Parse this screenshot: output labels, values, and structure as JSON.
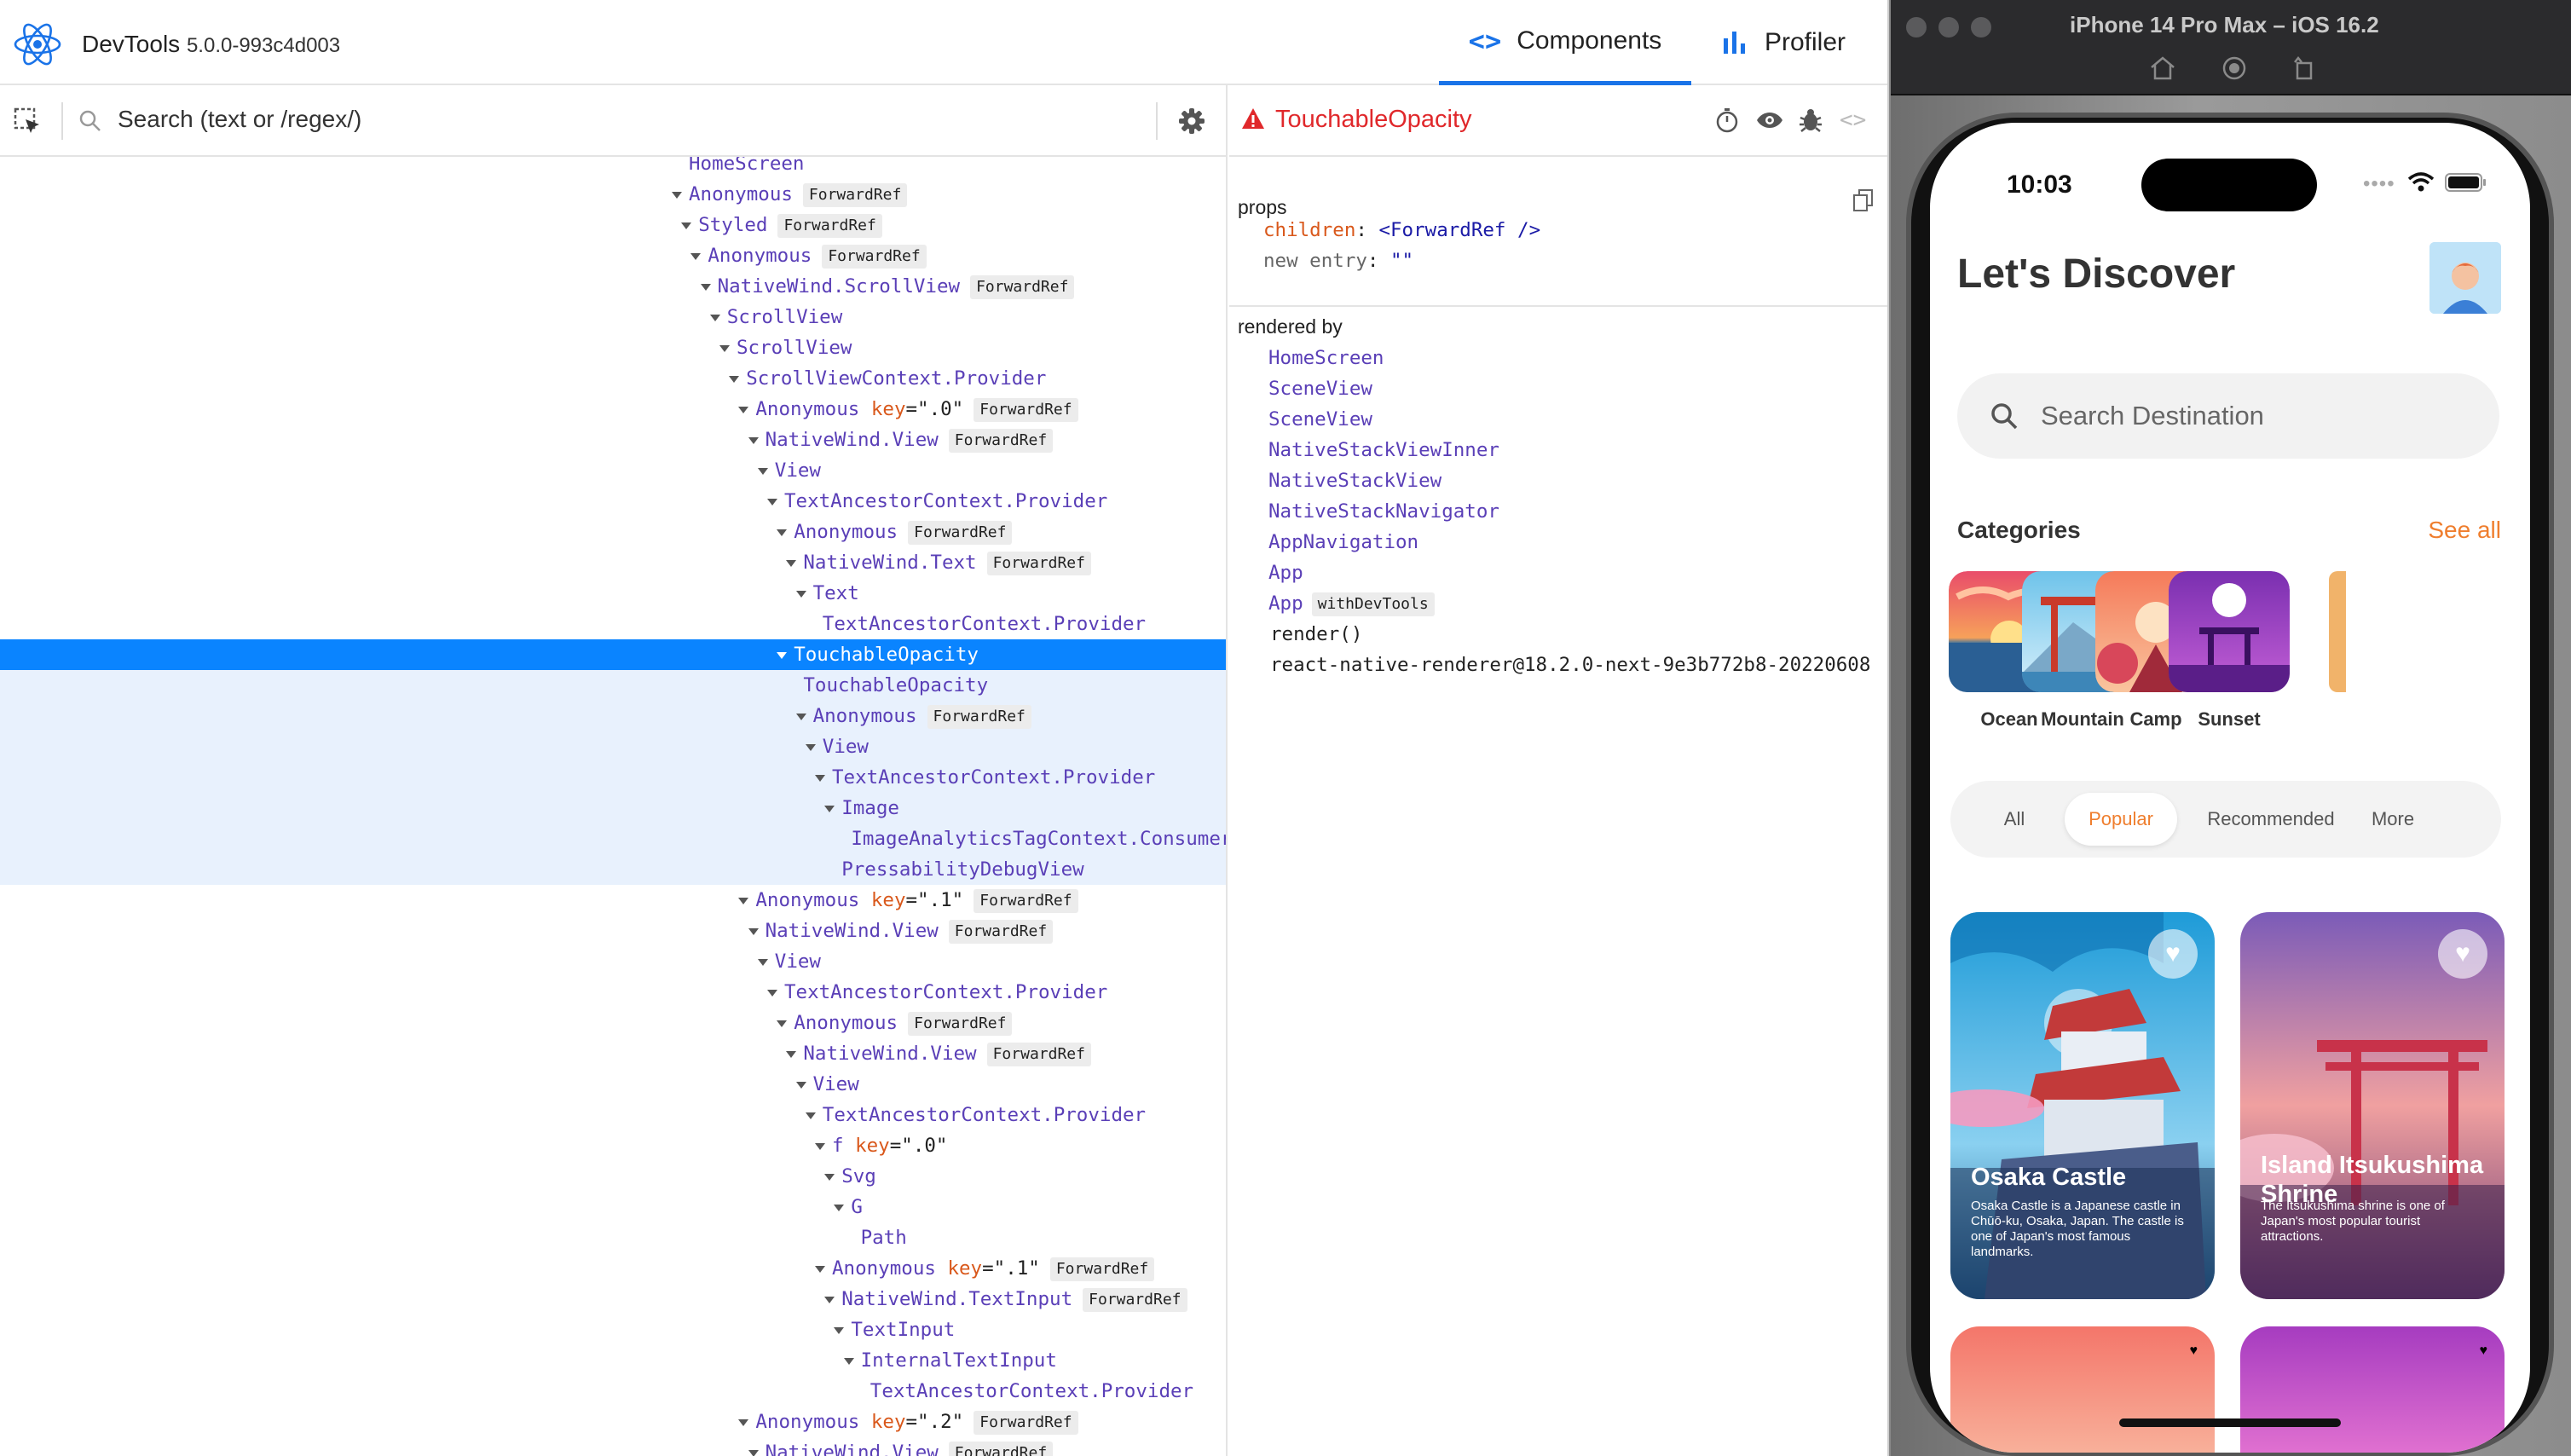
{
  "devtools": {
    "app_name": "DevTools",
    "version": "5.0.0-993c4d003",
    "tabs": [
      {
        "label": "Components",
        "active": true
      },
      {
        "label": "Profiler",
        "active": false
      }
    ],
    "search_placeholder": "Search (text or /regex/)",
    "tree": [
      {
        "indent": 0,
        "name": "HomeScreen",
        "partial": true
      },
      {
        "indent": 0,
        "name": "Anonymous",
        "badge": "ForwardRef",
        "caret": true
      },
      {
        "indent": 1,
        "name": "Styled",
        "badge": "ForwardRef",
        "caret": true
      },
      {
        "indent": 2,
        "name": "Anonymous",
        "badge": "ForwardRef",
        "caret": true
      },
      {
        "indent": 3,
        "name": "NativeWind.ScrollView",
        "badge": "ForwardRef",
        "caret": true
      },
      {
        "indent": 4,
        "name": "ScrollView",
        "caret": true
      },
      {
        "indent": 5,
        "name": "ScrollView",
        "caret": true
      },
      {
        "indent": 6,
        "name": "ScrollViewContext.Provider",
        "caret": true
      },
      {
        "indent": 7,
        "name": "Anonymous",
        "key": "\".0\"",
        "badge": "ForwardRef",
        "caret": true
      },
      {
        "indent": 8,
        "name": "NativeWind.View",
        "badge": "ForwardRef",
        "caret": true
      },
      {
        "indent": 9,
        "name": "View",
        "caret": true
      },
      {
        "indent": 10,
        "name": "TextAncestorContext.Provider",
        "caret": true
      },
      {
        "indent": 11,
        "name": "Anonymous",
        "badge": "ForwardRef",
        "caret": true
      },
      {
        "indent": 12,
        "name": "NativeWind.Text",
        "badge": "ForwardRef",
        "caret": true
      },
      {
        "indent": 13,
        "name": "Text",
        "caret": true
      },
      {
        "indent": 14,
        "name": "TextAncestorContext.Provider"
      },
      {
        "indent": 11,
        "name": "TouchableOpacity",
        "caret": true,
        "selected": true
      },
      {
        "indent": 12,
        "name": "TouchableOpacity",
        "sub": true
      },
      {
        "indent": 13,
        "name": "Anonymous",
        "badge": "ForwardRef",
        "caret": true,
        "sub": true
      },
      {
        "indent": 14,
        "name": "View",
        "caret": true,
        "sub": true
      },
      {
        "indent": 15,
        "name": "TextAncestorContext.Provider",
        "caret": true,
        "sub": true
      },
      {
        "indent": 16,
        "name": "Image",
        "caret": true,
        "sub": true
      },
      {
        "indent": 17,
        "name": "ImageAnalyticsTagContext.Consumer",
        "sub": true
      },
      {
        "indent": 16,
        "name": "PressabilityDebugView",
        "sub": true
      },
      {
        "indent": 7,
        "name": "Anonymous",
        "key": "\".1\"",
        "badge": "ForwardRef",
        "caret": true
      },
      {
        "indent": 8,
        "name": "NativeWind.View",
        "badge": "ForwardRef",
        "caret": true
      },
      {
        "indent": 9,
        "name": "View",
        "caret": true
      },
      {
        "indent": 10,
        "name": "TextAncestorContext.Provider",
        "caret": true
      },
      {
        "indent": 11,
        "name": "Anonymous",
        "badge": "ForwardRef",
        "caret": true
      },
      {
        "indent": 12,
        "name": "NativeWind.View",
        "badge": "ForwardRef",
        "caret": true
      },
      {
        "indent": 13,
        "name": "View",
        "caret": true
      },
      {
        "indent": 14,
        "name": "TextAncestorContext.Provider",
        "caret": true
      },
      {
        "indent": 15,
        "name": "f",
        "key": "\".0\"",
        "caret": true
      },
      {
        "indent": 16,
        "name": "Svg",
        "caret": true
      },
      {
        "indent": 17,
        "name": "G",
        "caret": true
      },
      {
        "indent": 18,
        "name": "Path"
      },
      {
        "indent": 15,
        "name": "Anonymous",
        "key": "\".1\"",
        "badge": "ForwardRef",
        "caret": true
      },
      {
        "indent": 16,
        "name": "NativeWind.TextInput",
        "badge": "ForwardRef",
        "caret": true
      },
      {
        "indent": 17,
        "name": "TextInput",
        "caret": true
      },
      {
        "indent": 18,
        "name": "InternalTextInput",
        "caret": true
      },
      {
        "indent": 19,
        "name": "TextAncestorContext.Provider"
      },
      {
        "indent": 7,
        "name": "Anonymous",
        "key": "\".2\"",
        "badge": "ForwardRef",
        "caret": true
      },
      {
        "indent": 8,
        "name": "NativeWind.View",
        "badge": "ForwardRef",
        "caret": true
      }
    ],
    "inspector": {
      "component": "TouchableOpacity",
      "props_label": "props",
      "props": [
        {
          "key": "children",
          "value": "<ForwardRef />"
        },
        {
          "key": "new entry",
          "value": "\"\""
        }
      ],
      "rendered_by_label": "rendered by",
      "rendered_by": [
        {
          "name": "HomeScreen",
          "link": true
        },
        {
          "name": "SceneView",
          "link": true
        },
        {
          "name": "SceneView",
          "link": true
        },
        {
          "name": "NativeStackViewInner",
          "link": true
        },
        {
          "name": "NativeStackView",
          "link": true
        },
        {
          "name": "NativeStackNavigator",
          "link": true
        },
        {
          "name": "AppNavigation",
          "link": true
        },
        {
          "name": "App",
          "link": true
        },
        {
          "name": "App",
          "link": true,
          "badge": "withDevTools"
        },
        {
          "name": "render()",
          "link": false
        },
        {
          "name": "react-native-renderer@18.2.0-next-9e3b772b8-20220608",
          "link": false
        }
      ]
    }
  },
  "simulator": {
    "title": "iPhone 14 Pro Max – iOS 16.2",
    "time": "10:03",
    "screen_title": "Let's Discover",
    "search_placeholder": "Search Destination",
    "categories_label": "Categories",
    "see_all": "See all",
    "categories": [
      "Ocean",
      "Mountain",
      "Camp",
      "Sunset"
    ],
    "filters": [
      {
        "label": "All",
        "active": false
      },
      {
        "label": "Popular",
        "active": true
      },
      {
        "label": "Recommended",
        "active": false
      },
      {
        "label": "More",
        "active": false
      }
    ],
    "cards": [
      {
        "name": "Osaka Castle",
        "desc": "Osaka Castle is a Japanese castle in Chūō-ku, Osaka, Japan. The castle is one of Japan's most famous landmarks."
      },
      {
        "name": "Island Itsukushima Shrine",
        "desc": "The Itsukushima shrine is one of Japan's most popular tourist attractions."
      }
    ],
    "accent": "#ef7e2e"
  }
}
